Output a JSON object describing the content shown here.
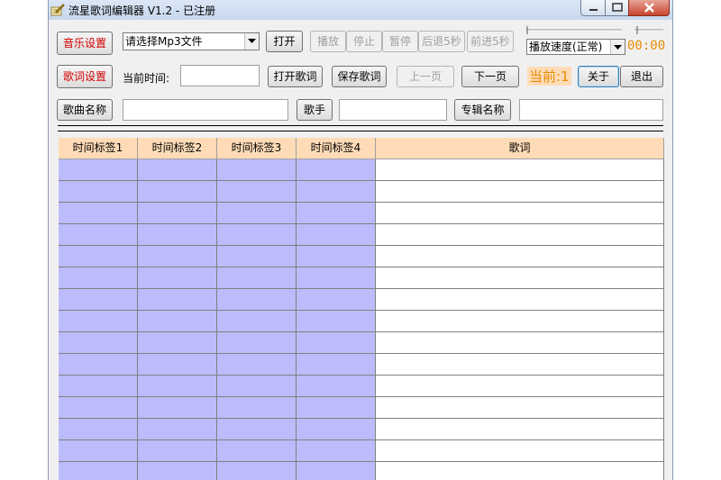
{
  "window": {
    "title": "流星歌词编辑器 V1.2 - 已注册"
  },
  "toolbar1": {
    "music_settings": "音乐设置",
    "mp3_select": "请选择Mp3文件",
    "open": "打开",
    "play": "播放",
    "stop": "停止",
    "pause": "暂停",
    "back5": "后退5秒",
    "forward5": "前进5秒",
    "speed": "播放速度(正常)",
    "time_display": "00:00"
  },
  "toolbar2": {
    "lyric_settings": "歌词设置",
    "current_time_label": "当前时间:",
    "current_time_value": "",
    "open_lyric": "打开歌词",
    "save_lyric": "保存歌词",
    "prev_page": "上一页",
    "next_page": "下一页",
    "current_page": "当前:1",
    "about": "关于",
    "exit": "退出"
  },
  "toolbar3": {
    "song_name": "歌曲名称",
    "song_name_value": "",
    "singer": "歌手",
    "singer_value": "",
    "album": "专辑名称",
    "album_value": ""
  },
  "table": {
    "columns": [
      "时间标签1",
      "时间标签2",
      "时间标签3",
      "时间标签4",
      "歌词"
    ],
    "visible_rows": 15
  },
  "colors": {
    "header_bg": "#ffdcb7",
    "timestamp_cell": "#bcbcfc",
    "lyric_cell": "#ffffff",
    "accent_red": "#d40000",
    "timer_orange": "#e88b00"
  }
}
